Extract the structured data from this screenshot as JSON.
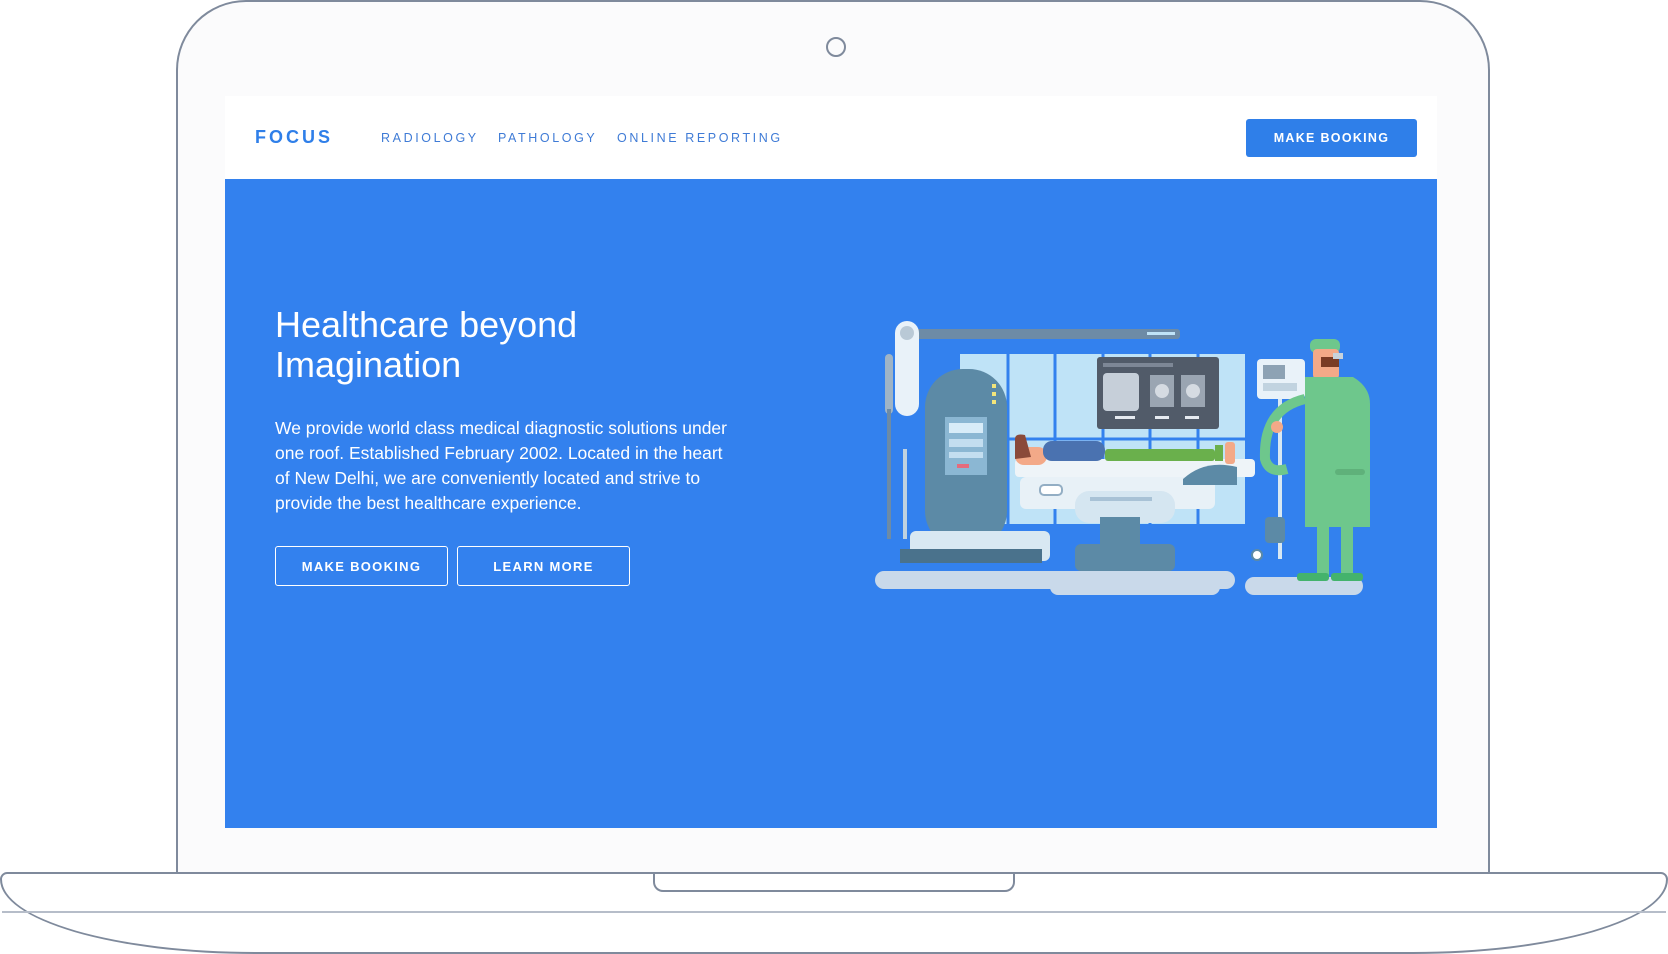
{
  "navbar": {
    "brand": "FOCUS",
    "links": [
      "RADIOLOGY",
      "PATHOLOGY",
      "ONLINE REPORTING"
    ],
    "cta_label": "MAKE BOOKING"
  },
  "hero": {
    "title": "Healthcare beyond Imagination",
    "description": "We provide world class medical diagnostic solutions under one roof. Established February 2002. Located in the heart of New Delhi, we are conveniently located and strive to provide the best healthcare experience.",
    "primary_button": "MAKE BOOKING",
    "secondary_button": "LEARN MORE",
    "illustration_icon": "radiology-scanner-illustration"
  },
  "colors": {
    "primary": "#3381ee",
    "brand": "#2f7fe9",
    "surface": "#ffffff"
  }
}
